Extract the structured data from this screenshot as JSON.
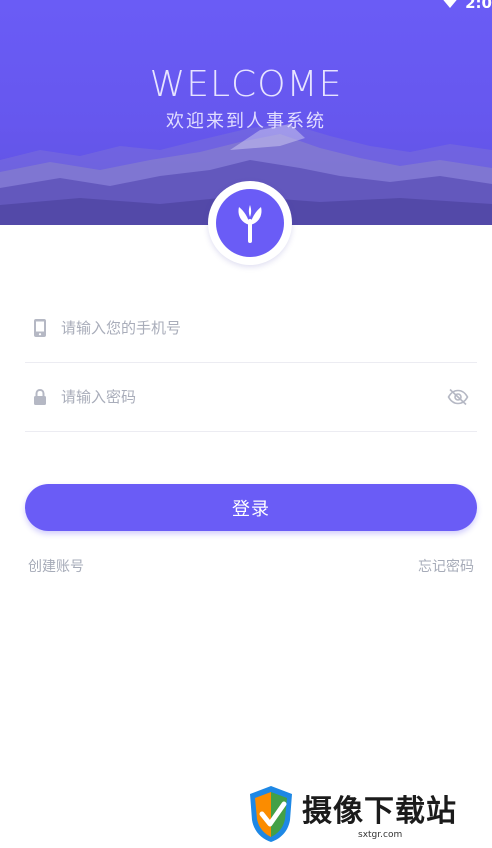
{
  "status_bar": {
    "time": "2:0"
  },
  "header": {
    "title": "WELCOME",
    "subtitle": "欢迎来到人事系统",
    "colors": {
      "accent": "#6a5cf6"
    }
  },
  "form": {
    "phone": {
      "placeholder": "请输入您的手机号",
      "value": "",
      "icon": "phone-icon"
    },
    "password": {
      "placeholder": "请输入密码",
      "value": "",
      "icon": "lock-icon",
      "toggle_icon": "eye-off-icon"
    },
    "login_label": "登录"
  },
  "links": {
    "create_account": "创建账号",
    "forgot_password": "忘记密码"
  },
  "watermark": {
    "title": "摄像下载站",
    "domain": "sxtgr.com"
  }
}
